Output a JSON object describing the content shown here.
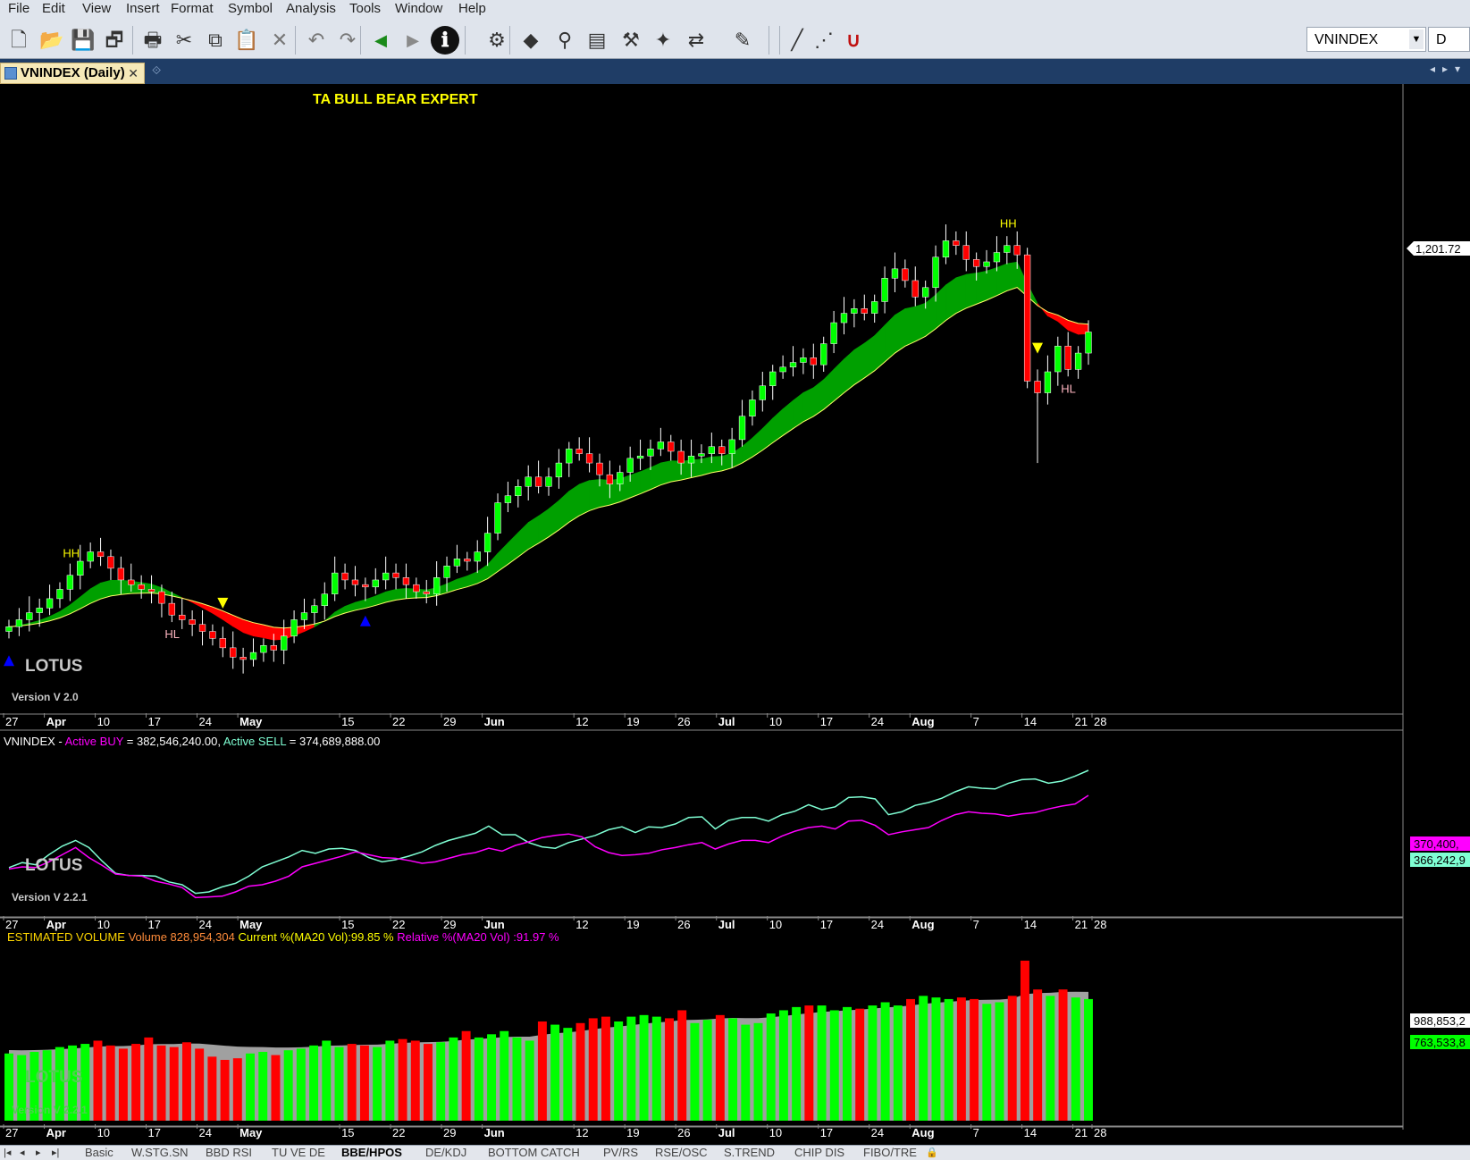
{
  "menu": [
    "File",
    "Edit",
    "View",
    "Insert",
    "Format",
    "Symbol",
    "Analysis",
    "Tools",
    "Window",
    "Help"
  ],
  "toolbar": {
    "icons": [
      "new-file-icon",
      "open-folder-icon",
      "save-icon",
      "save-all-icon",
      "print-icon",
      "cut-icon",
      "copy-icon",
      "paste-icon",
      "delete-icon",
      "undo-icon",
      "redo-icon",
      "back-icon",
      "forward-icon",
      "info-icon",
      "indicator-icon",
      "pattern-icon",
      "explore-icon",
      "report-icon",
      "tools-icon",
      "magic-icon",
      "trade-icon",
      "pen-icon",
      "line-icon",
      "dotted-line-icon",
      "magnet-icon"
    ],
    "symbol_value": "VNINDEX",
    "period_value": "D"
  },
  "tab": {
    "label": "VNINDEX (Daily)"
  },
  "colors": {
    "up": "#00ff00",
    "down": "#ff0000",
    "cloud_bull": "#00a000",
    "cloud_bear": "#ff0000",
    "buy_line": "#ff00ff",
    "sell_line": "#7fffd4",
    "volume_ma": "#a0a0a0"
  },
  "price_panel": {
    "title": "TA BULL BEAR EXPERT",
    "watermark": "LOTUS",
    "version": "Version V 2.0",
    "last_price_label": "1,201.72",
    "markers": [
      {
        "label": "HH",
        "date": "Apr 5"
      },
      {
        "label": "HL",
        "date": "Apr 25"
      },
      {
        "label": "HH",
        "date": "Aug 18"
      },
      {
        "label": "HL",
        "date": "Aug 24"
      }
    ]
  },
  "x_axis_labels": [
    "27",
    "Apr",
    "10",
    "17",
    "24",
    "May",
    "15",
    "22",
    "29",
    "Jun",
    "12",
    "19",
    "26",
    "Jul",
    "10",
    "17",
    "24",
    "Aug",
    "7",
    "14",
    "21",
    "28"
  ],
  "flow_panel": {
    "symbol": "VNINDEX",
    "sep": " - ",
    "buy_label": "Active BUY",
    "buy_value": " = 382,546,240.00, ",
    "sell_label": "Active SELL",
    "sell_value": " = 374,689,888.00",
    "watermark": "LOTUS",
    "version": "Version V 2.2.1",
    "buy_last": "370,400,",
    "sell_last": "366,242,9"
  },
  "volume_panel": {
    "title": "ESTIMATED VOLUME",
    "volume": "Volume 828,954,304",
    "current": "Current %(MA20 Vol):99.85 %",
    "relative": "Relative %(MA20 Vol) :91.97 %",
    "watermark": "LOTUS",
    "version": "Version V 2.2.1",
    "label_ma": "988,853,2",
    "label_vol": "763,533,8"
  },
  "bottom_tabs": [
    "Basic",
    "W.STG.SN",
    "BBD RSI",
    "TU VE DE",
    "BBE/HPOS",
    "DE/KDJ",
    "BOTTOM CATCH",
    "PV/RS",
    "RSE/OSC",
    "S.TREND",
    "CHIP DIS",
    "FIBO/TRE"
  ],
  "active_bottom_tab": "BBE/HPOS",
  "chart_data": {
    "type": "candlestick",
    "title": "TA BULL BEAR EXPERT",
    "symbol": "VNINDEX",
    "period": "Daily",
    "x_ticks": [
      "27",
      "Apr",
      "10",
      "17",
      "24",
      "May",
      "15",
      "22",
      "29",
      "Jun",
      "12",
      "19",
      "26",
      "Jul",
      "10",
      "17",
      "24",
      "Aug",
      "7",
      "14",
      "21",
      "28"
    ],
    "last_close": 1201.72,
    "close": [
      1040,
      1043,
      1046,
      1048,
      1052,
      1056,
      1062,
      1068,
      1072,
      1070,
      1065,
      1060,
      1058,
      1056,
      1055,
      1050,
      1045,
      1043,
      1041,
      1038,
      1035,
      1031,
      1027,
      1026,
      1029,
      1032,
      1030,
      1036,
      1043,
      1046,
      1049,
      1054,
      1063,
      1060,
      1058,
      1057,
      1060,
      1063,
      1061,
      1058,
      1055,
      1054,
      1061,
      1066,
      1069,
      1068,
      1072,
      1080,
      1093,
      1096,
      1100,
      1104,
      1100,
      1104,
      1110,
      1116,
      1114,
      1110,
      1105,
      1101,
      1106,
      1112,
      1113,
      1116,
      1119,
      1115,
      1110,
      1113,
      1114,
      1117,
      1114,
      1120,
      1130,
      1137,
      1143,
      1149,
      1151,
      1153,
      1155,
      1152,
      1161,
      1170,
      1174,
      1176,
      1174,
      1179,
      1189,
      1193,
      1188,
      1181,
      1185,
      1198,
      1205,
      1203,
      1197,
      1194,
      1196,
      1200,
      1203,
      1199,
      1145,
      1140,
      1149,
      1160,
      1150,
      1157,
      1166
    ],
    "buy_series": [
      272,
      275,
      274,
      282,
      292,
      302,
      288,
      277,
      265,
      263,
      262,
      255,
      251,
      246,
      232,
      233,
      234,
      240,
      248,
      250,
      255,
      262,
      275,
      280,
      285,
      290,
      296,
      292,
      288,
      287,
      284,
      280,
      282,
      287,
      292,
      295,
      301,
      297,
      305,
      310,
      316,
      319,
      321,
      317,
      303,
      295,
      291,
      292,
      294,
      299,
      302,
      306,
      309,
      300,
      307,
      312,
      312,
      309,
      318,
      325,
      330,
      332,
      328,
      339,
      340,
      333,
      320,
      324,
      327,
      330,
      340,
      348,
      352,
      350,
      349,
      346,
      349,
      351,
      356,
      360,
      363,
      375
    ],
    "sell_series": [
      274,
      281,
      278,
      292,
      304,
      312,
      302,
      283,
      266,
      263,
      263,
      262,
      254,
      250,
      238,
      240,
      247,
      252,
      262,
      275,
      282,
      289,
      298,
      294,
      300,
      301,
      298,
      288,
      282,
      285,
      290,
      296,
      305,
      312,
      317,
      322,
      332,
      320,
      320,
      309,
      303,
      301,
      309,
      314,
      319,
      327,
      331,
      323,
      331,
      330,
      335,
      344,
      345,
      328,
      340,
      344,
      344,
      339,
      348,
      353,
      362,
      355,
      359,
      372,
      373,
      370,
      348,
      352,
      361,
      365,
      371,
      380,
      387,
      385,
      384,
      392,
      397,
      398,
      392,
      395,
      402,
      410
    ],
    "volume_series": [
      420,
      410,
      430,
      440,
      460,
      470,
      480,
      500,
      470,
      450,
      480,
      520,
      470,
      460,
      490,
      450,
      400,
      380,
      390,
      420,
      430,
      410,
      440,
      450,
      470,
      500,
      460,
      480,
      470,
      460,
      500,
      510,
      500,
      480,
      490,
      520,
      560,
      520,
      540,
      560,
      520,
      500,
      620,
      600,
      580,
      610,
      640,
      650,
      620,
      650,
      660,
      650,
      640,
      690,
      610,
      630,
      660,
      640,
      600,
      610,
      670,
      690,
      710,
      720,
      720,
      690,
      710,
      700,
      720,
      740,
      720,
      760,
      780,
      770,
      760,
      770,
      760,
      730,
      740,
      780,
      1000,
      820,
      780,
      820,
      770,
      760
    ]
  }
}
